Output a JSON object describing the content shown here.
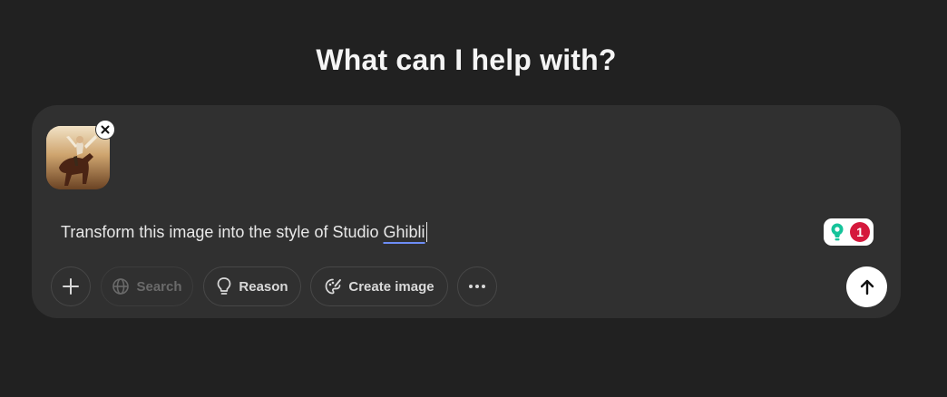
{
  "heading": "What can I help with?",
  "composer": {
    "attachment": {
      "icon": "image-thumbnail",
      "remove_icon": "close-icon"
    },
    "prompt_text": "Transform this image into the style of Studio ",
    "prompt_flagged_word": "Ghibli",
    "grammar_badge": {
      "icon": "lightbulb-icon",
      "count": "1",
      "colors": {
        "badge": "#d5183c",
        "icon": "#15c39a"
      }
    },
    "toolbar": {
      "attach_icon": "plus-icon",
      "search_label": "Search",
      "reason_label": "Reason",
      "create_image_label": "Create image",
      "more_icon": "ellipsis-icon",
      "send_icon": "arrow-up-icon"
    }
  },
  "colors": {
    "background": "#212121",
    "composer": "#303030",
    "underline": "#6d8df5"
  }
}
